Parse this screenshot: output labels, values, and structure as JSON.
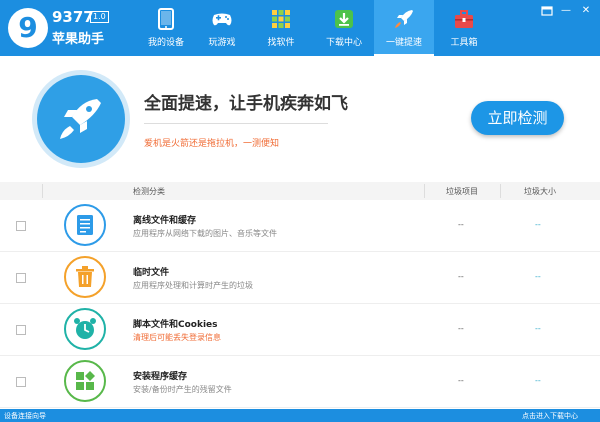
{
  "app": {
    "logo_number": "9377",
    "logo_version": "1.0",
    "logo_name": "苹果助手",
    "logo_mark": "9"
  },
  "window_controls": {
    "skin_icon": "skin-icon",
    "minimize": "—",
    "close": "✕"
  },
  "nav": {
    "items": [
      {
        "label": "我的设备",
        "icon": "tablet-icon"
      },
      {
        "label": "玩游戏",
        "icon": "gamepad-icon"
      },
      {
        "label": "找软件",
        "icon": "apps-grid-icon"
      },
      {
        "label": "下载中心",
        "icon": "download-icon"
      },
      {
        "label": "一键提速",
        "icon": "rocket-icon",
        "active": true
      },
      {
        "label": "工具箱",
        "icon": "toolbox-icon"
      }
    ]
  },
  "hero": {
    "title": "全面提速，让手机疾奔如飞",
    "subtitle": "爱机是火箭还是拖拉机，一测便知",
    "detect_button": "立即检测"
  },
  "table": {
    "headers": {
      "category": "检测分类",
      "items": "垃圾项目",
      "size": "垃圾大小"
    },
    "rows": [
      {
        "title": "离线文件和缓存",
        "desc": "应用程序从网络下载的图片、音乐等文件",
        "items": "--",
        "size": "--",
        "icon": "document-icon",
        "warn": false
      },
      {
        "title": "临时文件",
        "desc": "应用程序处理和计算时产生的垃圾",
        "items": "--",
        "size": "--",
        "icon": "trash-icon",
        "warn": false
      },
      {
        "title": "脚本文件和Cookies",
        "desc": "清理后可能丢失登录信息",
        "items": "--",
        "size": "--",
        "icon": "alarm-clock-icon",
        "warn": true
      },
      {
        "title": "安装程序缓存",
        "desc": "安装/备份时产生的残留文件",
        "items": "--",
        "size": "--",
        "icon": "app-blocks-icon",
        "warn": false
      }
    ]
  },
  "status": {
    "left": "设备连接向导",
    "right": "点击进入下载中心"
  },
  "colors": {
    "brand_blue": "#1c8ee0",
    "accent_orange": "#f06b34",
    "icon_blue": "#2d9be8",
    "icon_orange": "#f4a12a",
    "icon_teal": "#1fb2a7",
    "icon_green": "#58b84a"
  }
}
